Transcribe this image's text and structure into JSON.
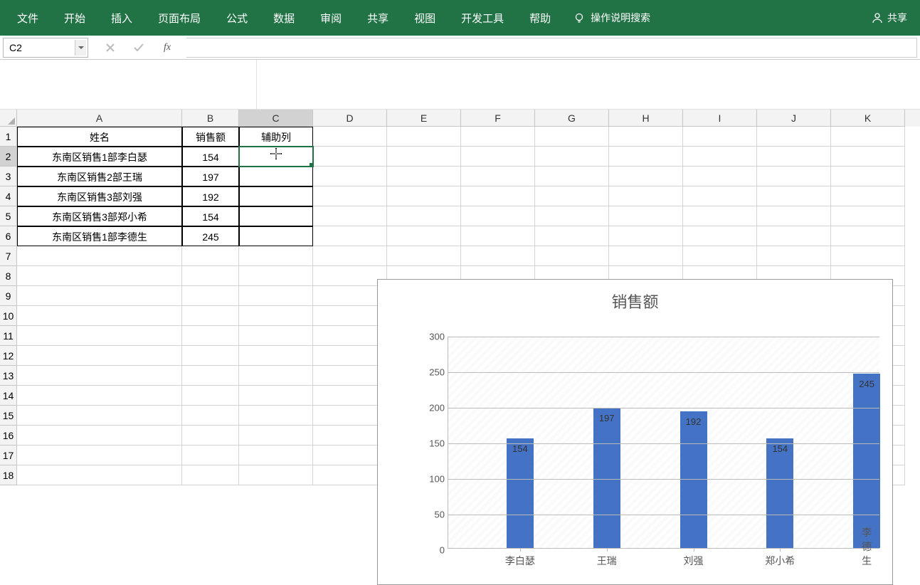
{
  "ribbon": {
    "tabs": [
      "文件",
      "开始",
      "插入",
      "页面布局",
      "公式",
      "数据",
      "审阅",
      "共享",
      "视图",
      "开发工具",
      "帮助"
    ],
    "search_placeholder": "操作说明搜索",
    "share_label": "共享"
  },
  "name_box": {
    "value": "C2"
  },
  "formula_bar": {
    "value": ""
  },
  "columns": {
    "labels": [
      "A",
      "B",
      "C",
      "D",
      "E",
      "F",
      "G",
      "H",
      "I",
      "J",
      "K"
    ],
    "widths": [
      232,
      80,
      104,
      104,
      104,
      104,
      104,
      104,
      104,
      104,
      104
    ],
    "selected": "C"
  },
  "rows": {
    "count": 18,
    "selected": 2
  },
  "sheet": {
    "headers": {
      "A": "姓名",
      "B": "销售额",
      "C": "辅助列"
    },
    "data": [
      {
        "name": "东南区销售1部李白瑟",
        "value": "154"
      },
      {
        "name": "东南区销售2部王瑞",
        "value": "197"
      },
      {
        "name": "东南区销售3部刘强",
        "value": "192"
      },
      {
        "name": "东南区销售3部郑小希",
        "value": "154"
      },
      {
        "name": "东南区销售1部李德生",
        "value": "245"
      }
    ],
    "active_cell": "C2"
  },
  "chart_data": {
    "type": "bar",
    "title": "销售额",
    "categories": [
      "李白瑟",
      "王瑞",
      "刘强",
      "郑小希",
      "李德生"
    ],
    "values": [
      154,
      197,
      192,
      154,
      245
    ],
    "ylim": [
      0,
      300
    ],
    "ystep": 50,
    "xlabel": "",
    "ylabel": ""
  }
}
